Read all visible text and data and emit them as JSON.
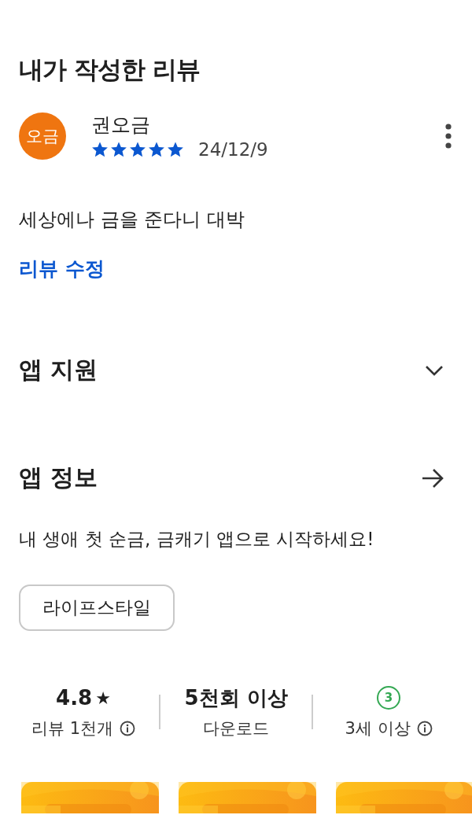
{
  "my_review": {
    "title": "내가 작성한 리뷰",
    "avatar": {
      "initials": "오금",
      "color": "#ef7510"
    },
    "author": "권오금",
    "stars": 5,
    "date": "24/12/9",
    "text": "세상에나 금을 준다니 대박",
    "edit_link": "리뷰 수정"
  },
  "app_support": {
    "title": "앱 지원",
    "expanded": false
  },
  "app_info": {
    "title": "앱 정보",
    "description": "내 생애 첫 순금, 금캐기 앱으로 시작하세요!",
    "category": "라이프스타일"
  },
  "stats": [
    {
      "kind": "rating",
      "value": "4.8",
      "star": "★",
      "label": "리뷰 1천개"
    },
    {
      "kind": "plain",
      "value": "5천회 이상",
      "label": "다운로드"
    },
    {
      "kind": "age",
      "value": "3",
      "label": "3세 이상"
    }
  ]
}
